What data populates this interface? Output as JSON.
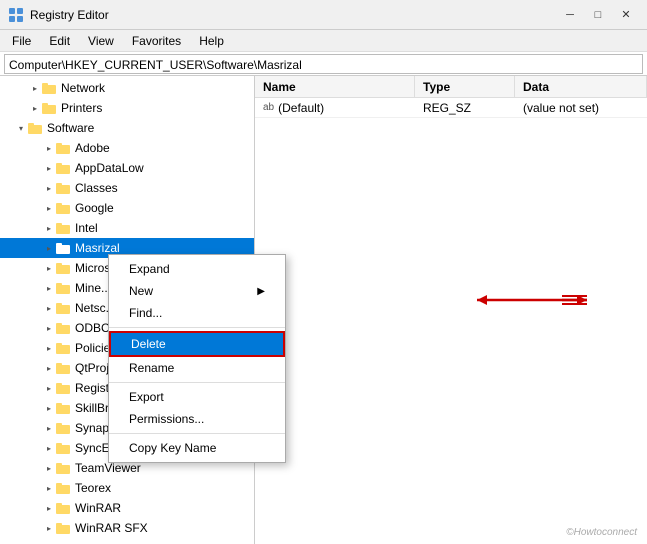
{
  "titleBar": {
    "title": "Registry Editor",
    "minBtn": "─",
    "maxBtn": "□",
    "closeBtn": "✕"
  },
  "menuBar": {
    "items": [
      "File",
      "Edit",
      "View",
      "Favorites",
      "Help"
    ]
  },
  "addressBar": {
    "path": "Computer\\HKEY_CURRENT_USER\\Software\\Masrizal"
  },
  "tree": {
    "items": [
      {
        "id": "network",
        "label": "Network",
        "indent": 2,
        "expander": "collapsed",
        "selected": false
      },
      {
        "id": "printers",
        "label": "Printers",
        "indent": 2,
        "expander": "collapsed",
        "selected": false
      },
      {
        "id": "software",
        "label": "Software",
        "indent": 1,
        "expander": "expanded",
        "selected": false
      },
      {
        "id": "adobe",
        "label": "Adobe",
        "indent": 3,
        "expander": "collapsed",
        "selected": false
      },
      {
        "id": "appdatalow",
        "label": "AppDataLow",
        "indent": 3,
        "expander": "collapsed",
        "selected": false
      },
      {
        "id": "classes",
        "label": "Classes",
        "indent": 3,
        "expander": "collapsed",
        "selected": false
      },
      {
        "id": "google",
        "label": "Google",
        "indent": 3,
        "expander": "collapsed",
        "selected": false
      },
      {
        "id": "intel",
        "label": "Intel",
        "indent": 3,
        "expander": "collapsed",
        "selected": false
      },
      {
        "id": "masrizal",
        "label": "Masrizal",
        "indent": 3,
        "expander": "collapsed",
        "selected": true
      },
      {
        "id": "micros",
        "label": "Micros...",
        "indent": 3,
        "expander": "collapsed",
        "selected": false
      },
      {
        "id": "mine",
        "label": "Mine...",
        "indent": 3,
        "expander": "collapsed",
        "selected": false
      },
      {
        "id": "netsc",
        "label": "Netsc...",
        "indent": 3,
        "expander": "collapsed",
        "selected": false
      },
      {
        "id": "odbc",
        "label": "ODBC...",
        "indent": 3,
        "expander": "collapsed",
        "selected": false
      },
      {
        "id": "policie",
        "label": "Policie...",
        "indent": 3,
        "expander": "collapsed",
        "selected": false
      },
      {
        "id": "qtproj",
        "label": "QtProj...",
        "indent": 3,
        "expander": "collapsed",
        "selected": false
      },
      {
        "id": "regist",
        "label": "Regist...",
        "indent": 3,
        "expander": "collapsed",
        "selected": false
      },
      {
        "id": "skillbr",
        "label": "SkillBr...",
        "indent": 3,
        "expander": "collapsed",
        "selected": false
      },
      {
        "id": "synap",
        "label": "Synap...",
        "indent": 3,
        "expander": "collapsed",
        "selected": false
      },
      {
        "id": "synce",
        "label": "SyncE...",
        "indent": 3,
        "expander": "collapsed",
        "selected": false
      },
      {
        "id": "teamviewer",
        "label": "TeamViewer",
        "indent": 3,
        "expander": "collapsed",
        "selected": false
      },
      {
        "id": "teorex",
        "label": "Teorex",
        "indent": 3,
        "expander": "collapsed",
        "selected": false
      },
      {
        "id": "winrar",
        "label": "WinRAR",
        "indent": 3,
        "expander": "collapsed",
        "selected": false
      },
      {
        "id": "winrarsfx",
        "label": "WinRAR SFX",
        "indent": 3,
        "expander": "collapsed",
        "selected": false
      }
    ]
  },
  "rightPane": {
    "columns": {
      "name": "Name",
      "type": "Type",
      "data": "Data"
    },
    "rows": [
      {
        "name": "(Default)",
        "type": "REG_SZ",
        "data": "(value not set)",
        "isDefault": true
      }
    ]
  },
  "contextMenu": {
    "items": [
      {
        "id": "expand",
        "label": "Expand",
        "hasArrow": false,
        "highlighted": false,
        "separator": false
      },
      {
        "id": "new",
        "label": "New",
        "hasArrow": true,
        "highlighted": false,
        "separator": false
      },
      {
        "id": "find",
        "label": "Find...",
        "hasArrow": false,
        "highlighted": false,
        "separator": true
      },
      {
        "id": "delete",
        "label": "Delete",
        "hasArrow": false,
        "highlighted": true,
        "separator": false
      },
      {
        "id": "rename",
        "label": "Rename",
        "hasArrow": false,
        "highlighted": false,
        "separator": true
      },
      {
        "id": "export",
        "label": "Export",
        "hasArrow": false,
        "highlighted": false,
        "separator": false
      },
      {
        "id": "permissions",
        "label": "Permissions...",
        "hasArrow": false,
        "highlighted": false,
        "separator": true
      },
      {
        "id": "copykey",
        "label": "Copy Key Name",
        "hasArrow": false,
        "highlighted": false,
        "separator": false
      }
    ]
  },
  "watermark": "©Howtoconnect"
}
